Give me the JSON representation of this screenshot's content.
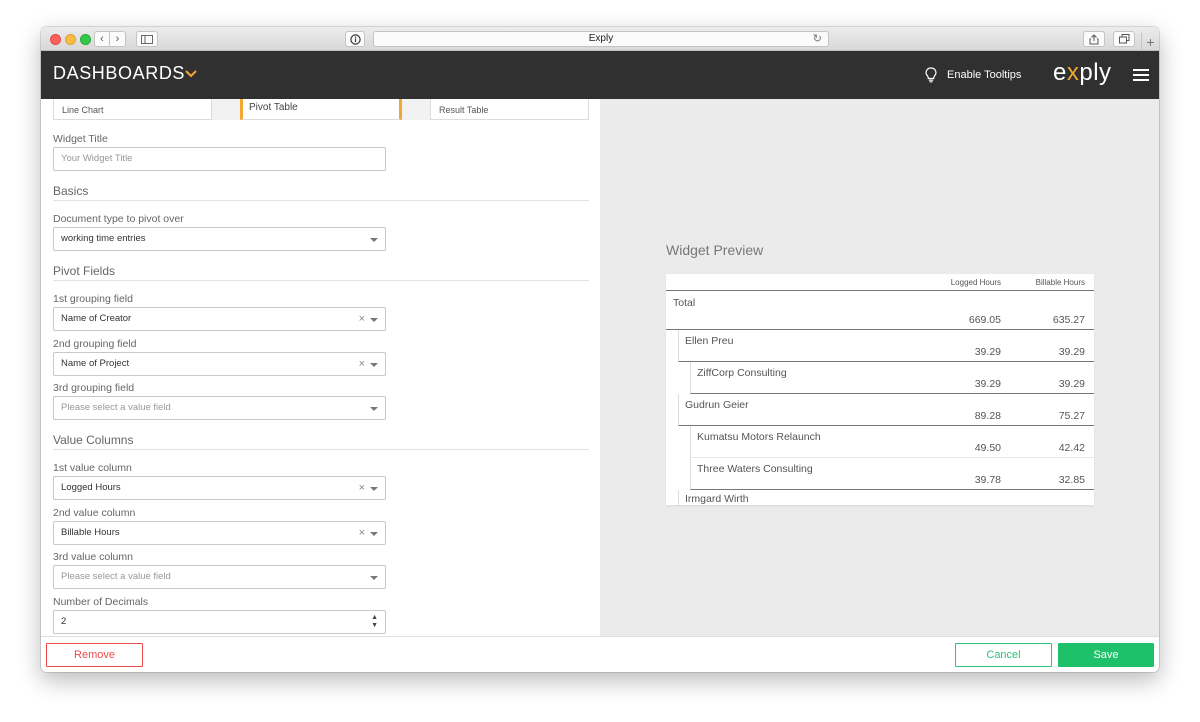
{
  "browser": {
    "title": "Exply",
    "icons": {
      "back": "chevron-left-icon",
      "forward": "chevron-right-icon",
      "sidebar": "sidebar-icon",
      "info": "info-icon",
      "reload": "reload-icon",
      "share": "share-icon",
      "tabs": "tabs-icon",
      "new_tab": "plus-icon"
    }
  },
  "header": {
    "title": "DASHBOARDS",
    "tooltip_label": "Enable Tooltips",
    "logo_pre": "e",
    "logo_x": "x",
    "logo_post": "ply",
    "accent": "#f0a830",
    "background": "#303030"
  },
  "widget_types": [
    {
      "label": "Line Chart",
      "selected": false
    },
    {
      "label": "Pivot Table",
      "selected": true
    },
    {
      "label": "Result Table",
      "selected": false
    }
  ],
  "form": {
    "widget_title": {
      "label": "Widget Title",
      "placeholder": "Your Widget Title",
      "value": ""
    },
    "basics": {
      "title": "Basics",
      "doc_type": {
        "label": "Document type to pivot over",
        "value": "working time entries"
      }
    },
    "pivot_fields": {
      "title": "Pivot Fields",
      "group1": {
        "label": "1st grouping field",
        "value": "Name of Creator"
      },
      "group2": {
        "label": "2nd grouping field",
        "value": "Name of Project"
      },
      "group3": {
        "label": "3rd grouping field",
        "placeholder": "Please select a value field"
      }
    },
    "value_columns": {
      "title": "Value Columns",
      "value1": {
        "label": "1st value column",
        "value": "Logged Hours"
      },
      "value2": {
        "label": "2nd value column",
        "value": "Billable Hours"
      },
      "value3": {
        "label": "3rd value column",
        "placeholder": "Please select a value field"
      },
      "decimals": {
        "label": "Number of Decimals",
        "value": "2"
      }
    }
  },
  "preview": {
    "title": "Widget Preview",
    "columns": [
      "Logged Hours",
      "Billable Hours"
    ],
    "rows": [
      {
        "name": "Total",
        "logged": "669.05",
        "billable": "635.27",
        "level": 0
      },
      {
        "name": "Ellen Preu",
        "logged": "39.29",
        "billable": "39.29",
        "level": 1
      },
      {
        "name": "ZiffCorp Consulting",
        "logged": "39.29",
        "billable": "39.29",
        "level": 2
      },
      {
        "name": "Gudrun Geier",
        "logged": "89.28",
        "billable": "75.27",
        "level": 1
      },
      {
        "name": "Kumatsu Motors Relaunch",
        "logged": "49.50",
        "billable": "42.42",
        "level": 2
      },
      {
        "name": "Three Waters Consulting",
        "logged": "39.78",
        "billable": "32.85",
        "level": 2
      },
      {
        "name": "Irmgard Wirth",
        "level": 1
      }
    ]
  },
  "footer": {
    "remove": "Remove",
    "cancel": "Cancel",
    "save": "Save",
    "colors": {
      "danger": "#ee4b4b",
      "success": "#1ec16a"
    }
  }
}
